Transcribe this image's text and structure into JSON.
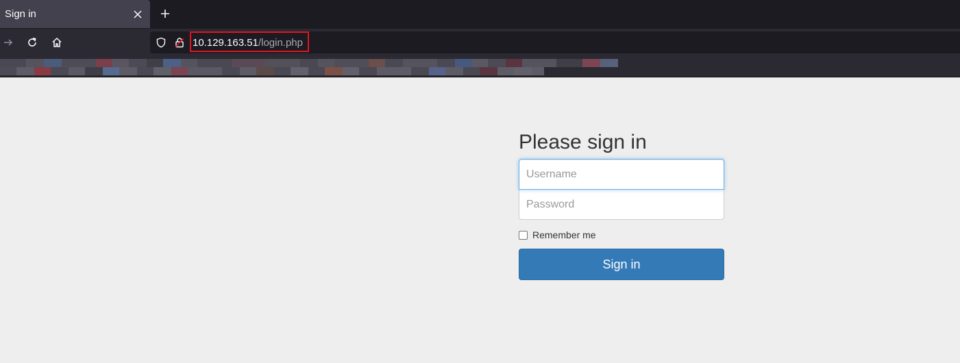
{
  "browser": {
    "tab": {
      "title": "Sign in",
      "close_icon": "close-icon"
    },
    "new_tab_icon": "plus-icon",
    "nav": {
      "forward_icon": "arrow-right-icon",
      "reload_icon": "reload-icon",
      "home_icon": "home-icon"
    },
    "url": {
      "host": "10.129.163.51",
      "path": "/login.php",
      "shield_icon": "shield-icon",
      "lock_icon": "insecure-lock-icon",
      "highlight_color": "#e0141e"
    },
    "bookmarks_toolbar": {
      "state": "redacted"
    }
  },
  "login_form": {
    "heading": "Please sign in",
    "username": {
      "placeholder": "Username",
      "value": ""
    },
    "password": {
      "placeholder": "Password",
      "value": ""
    },
    "remember_me": {
      "label": "Remember me",
      "checked": false
    },
    "submit_label": "Sign in",
    "accent_color": "#337ab7"
  }
}
